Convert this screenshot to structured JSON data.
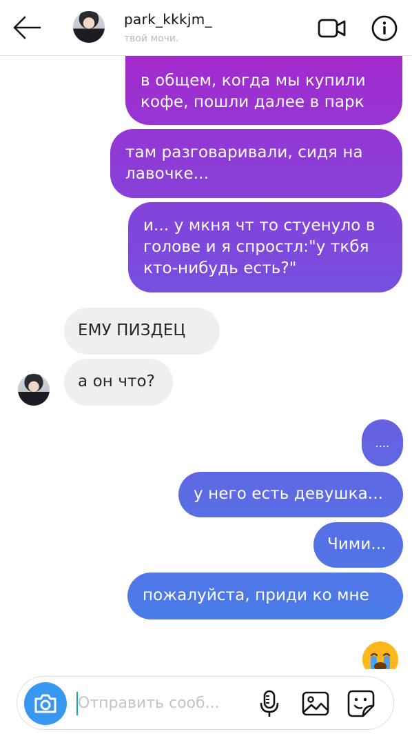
{
  "header": {
    "username": "park_kkkjm_",
    "status": "твой мочи.",
    "icons": {
      "back": "back-arrow-icon",
      "video": "video-call-icon",
      "info": "info-icon"
    }
  },
  "messages": [
    {
      "sender": "me",
      "text": "в общем, когда мы купили\nкофе, пошли далее в парк"
    },
    {
      "sender": "me",
      "text": "там разговаривали, сидя на\nлавочке..."
    },
    {
      "sender": "me",
      "text": "и... у мкня чт то стуенуло в\nголове и я спростл:\"у ткбя\nкто-нибудь есть?\""
    },
    {
      "sender": "friend",
      "text": "ЕМУ ПИЗДЕЦ"
    },
    {
      "sender": "friend",
      "text": "а он что?"
    },
    {
      "sender": "me",
      "text": "...."
    },
    {
      "sender": "me",
      "text": "у него есть девушка..."
    },
    {
      "sender": "me",
      "text": "Чими..."
    },
    {
      "sender": "me",
      "text": "пожалуйста, приди ко мне"
    }
  ],
  "reaction": {
    "icon": "crying-face-emoji-icon"
  },
  "composer": {
    "placeholder": "Отправить сооб...",
    "value": "",
    "icons": {
      "camera": "camera-icon",
      "mic": "microphone-icon",
      "gallery": "gallery-icon",
      "sticker": "sticker-icon"
    }
  },
  "colors": {
    "gradient_top": "#b021c9",
    "gradient_mid": "#8046dc",
    "gradient_bottom": "#4a7ce8",
    "incoming_bubble": "#efefef",
    "camera_button": "#3897f0"
  }
}
